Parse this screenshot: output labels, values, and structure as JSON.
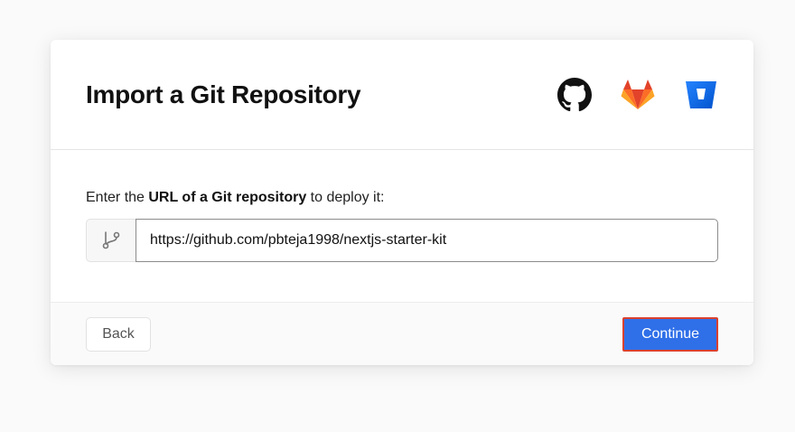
{
  "header": {
    "title": "Import a Git Repository",
    "providers": [
      {
        "name": "GitHub",
        "icon": "github-icon",
        "color": "#111111"
      },
      {
        "name": "GitLab",
        "icon": "gitlab-icon",
        "color": "#e2432a"
      },
      {
        "name": "Bitbucket",
        "icon": "bitbucket-icon",
        "color": "#2684ff"
      }
    ]
  },
  "form": {
    "prompt_prefix": "Enter the ",
    "prompt_bold": "URL of a Git repository",
    "prompt_suffix": " to deploy it:",
    "prefix_icon": "git-branch-icon",
    "url_value": "https://github.com/pbteja1998/nextjs-starter-kit"
  },
  "footer": {
    "back_label": "Back",
    "continue_label": "Continue",
    "continue_color": "#2f6fe8",
    "highlight_color": "#d9412f"
  }
}
